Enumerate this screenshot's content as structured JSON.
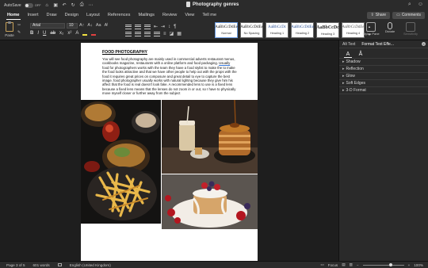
{
  "titlebar": {
    "autosave_label": "AutoSave",
    "autosave_state": "OFF",
    "doc_title": "Photography genres"
  },
  "tabs": [
    "Home",
    "Insert",
    "Draw",
    "Design",
    "Layout",
    "References",
    "Mailings",
    "Review",
    "View",
    "Tell me"
  ],
  "active_tab": "Home",
  "toolbar": {
    "share_label": "Share",
    "comments_label": "Comments",
    "paste_label": "Paste",
    "font_name": "Arial",
    "font_size": "10",
    "styles_pane_label": "Styles Pane",
    "dictate_label": "Dictate",
    "sensitivity_label": "Sensitivity"
  },
  "styles": [
    {
      "preview": "AaBbCcDdEe",
      "name": "Normal"
    },
    {
      "preview": "AaBbCcDdEe",
      "name": "No Spacing"
    },
    {
      "preview": "AaBbCcDc",
      "name": "Heading 1"
    },
    {
      "preview": "AaBbCcDdEe",
      "name": "Heading 2"
    },
    {
      "preview": "AaBbCcDc",
      "name": "Heading 3"
    },
    {
      "preview": "AaBbCcDdEe",
      "name": "Heading 4"
    }
  ],
  "document": {
    "heading": "FOOD PHOTOGRAPHY",
    "body_part1": "You will see food photography are mainly used in commercial adverts restaurant menus, cookbooks magazine, restaurants with a online platform and food packaging. ",
    "body_err": "Usually",
    "body_part2": " food for photographers works with the team they have a food stylist to make the to make the food looks attractive and that we have other people to help out with the props with the food it requires great prices on composure and great detail to eye to capture the best image. food photographer usually works with natural lighting because they give him his affect that the food is real doesn't look fake. A recommended lens to use is a fixed lens because a fixed lens means that the lenses do not zoom in or out, so I have to physically move myself closer or further away from the subject"
  },
  "pane": {
    "tab_alt_text": "Alt Text",
    "tab_format": "Format Text Effe...",
    "sections": [
      "Shadow",
      "Reflection",
      "Glow",
      "Soft Edges",
      "3-D Format"
    ]
  },
  "status": {
    "page": "Page 3 of 5",
    "words": "601 words",
    "language": "English (United Kingdom)",
    "focus": "Focus",
    "zoom": "100%"
  }
}
